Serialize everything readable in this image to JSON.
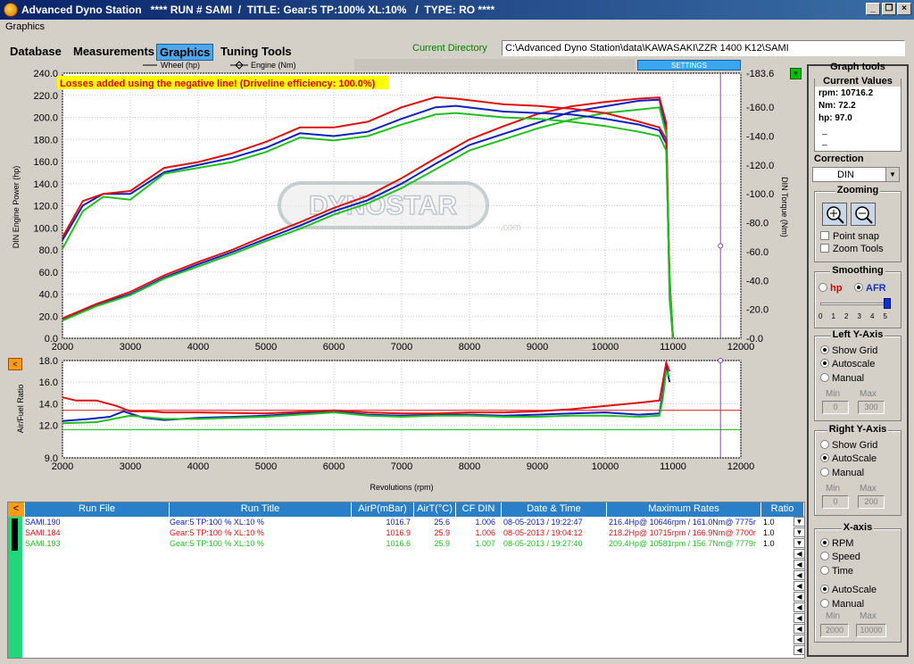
{
  "window": {
    "title": "Advanced Dyno Station   **** RUN # SAMI  /  TITLE: Gear:5 TP:100% XL:10%   /  TYPE: RO ****",
    "menu": "Graphics"
  },
  "tabs": [
    "Database",
    "Measurements",
    "Graphics",
    "Tuning Tools"
  ],
  "current_directory": {
    "label": "Current Directory",
    "value": "C:\\Advanced Dyno Station\\data\\KAWASAKI\\ZZR 1400 K12\\SAMI"
  },
  "settings_label": "SETTINGS",
  "loss_note": "Losses added using the negative line! (Driveline efficiency: 100.0%)",
  "watermark": "DYNOSTAR",
  "watermark_sub": ".com",
  "chart_data": [
    {
      "type": "line",
      "legend": [
        "Wheel (hp)",
        "Engine (Nm)"
      ],
      "xlabel": "",
      "ylabel": "DIN Engine Power (hp)",
      "y2label": "DIN Torque (Nm)",
      "xlim": [
        2000,
        12000
      ],
      "ylim": [
        0,
        240
      ],
      "y2lim": [
        0,
        183.6
      ],
      "x_ticks": [
        2000,
        3000,
        4000,
        5000,
        6000,
        7000,
        8000,
        9000,
        10000,
        11000,
        12000
      ],
      "y_ticks": [
        "0.0",
        "20.0",
        "40.0",
        "60.0",
        "80.0",
        "100.0",
        "120.0",
        "140.0",
        "160.0",
        "180.0",
        "200.0",
        "220.0",
        "240.0"
      ],
      "y2_ticks": [
        "-0.0",
        "-20.0",
        "-40.0",
        "-60.0",
        "-80.0",
        "-100.0",
        "-120.0",
        "-140.0",
        "-160.0",
        "-183.6"
      ],
      "cursor_rpm": 11700,
      "series": [
        {
          "name": "SAMI.190 hp",
          "color": "#1020c0",
          "x": [
            2000,
            2500,
            3000,
            3500,
            4000,
            4500,
            5000,
            5500,
            6000,
            6500,
            7000,
            7500,
            8000,
            8500,
            9000,
            9500,
            10000,
            10500,
            10800,
            10900,
            10950,
            11000
          ],
          "values": [
            17,
            30,
            40,
            55,
            67,
            78,
            90,
            102,
            115,
            125,
            140,
            158,
            175,
            185,
            195,
            205,
            210,
            215,
            216,
            190,
            40,
            0
          ]
        },
        {
          "name": "SAMI.184 hp",
          "color": "#e01010",
          "x": [
            2000,
            2500,
            3000,
            3500,
            4000,
            4500,
            5000,
            5500,
            6000,
            6500,
            7000,
            7500,
            8000,
            8500,
            9000,
            9500,
            10000,
            10500,
            10800,
            10900,
            10950,
            11000
          ],
          "values": [
            18,
            31,
            42,
            57,
            69,
            80,
            93,
            105,
            118,
            129,
            145,
            163,
            180,
            192,
            203,
            210,
            214,
            217,
            218,
            195,
            45,
            0
          ]
        },
        {
          "name": "SAMI.193 hp",
          "color": "#20c020",
          "x": [
            2000,
            2500,
            3000,
            3500,
            4000,
            4500,
            5000,
            5500,
            6000,
            6500,
            7000,
            7500,
            8000,
            8500,
            9000,
            9500,
            10000,
            10500,
            10800,
            10900,
            10950,
            11000
          ],
          "values": [
            16,
            29,
            39,
            54,
            65,
            76,
            88,
            99,
            112,
            122,
            136,
            153,
            170,
            180,
            190,
            198,
            204,
            207,
            209,
            185,
            35,
            0
          ]
        },
        {
          "name": "SAMI.190 Nm",
          "color": "#1020c0",
          "x": [
            2000,
            2300,
            2600,
            3000,
            3500,
            4000,
            4500,
            5000,
            5500,
            6000,
            6500,
            7000,
            7500,
            7800,
            8500,
            9000,
            9500,
            10000,
            10500,
            10800,
            10900,
            10950,
            11000
          ],
          "values": [
            68,
            92,
            100,
            100,
            115,
            120,
            125,
            132,
            142,
            140,
            143,
            152,
            160,
            161,
            157,
            156,
            155,
            152,
            148,
            144,
            135,
            40,
            0
          ]
        },
        {
          "name": "SAMI.184 Nm",
          "color": "#e01010",
          "x": [
            2000,
            2300,
            2600,
            3000,
            3500,
            4000,
            4500,
            5000,
            5500,
            6000,
            6500,
            7000,
            7500,
            7800,
            8500,
            9000,
            9500,
            10000,
            10500,
            10800,
            10900,
            10950,
            11000
          ],
          "values": [
            70,
            95,
            100,
            102,
            118,
            122,
            128,
            136,
            146,
            146,
            150,
            160,
            167,
            166,
            162,
            161,
            159,
            156,
            150,
            146,
            138,
            42,
            0
          ]
        },
        {
          "name": "SAMI.193 Nm",
          "color": "#20c020",
          "x": [
            2000,
            2300,
            2600,
            3000,
            3500,
            4000,
            4500,
            5000,
            5500,
            6000,
            6500,
            7000,
            7500,
            7800,
            8500,
            9000,
            9500,
            10000,
            10500,
            10800,
            10900,
            10950,
            11000
          ],
          "values": [
            62,
            88,
            98,
            96,
            114,
            118,
            122,
            129,
            139,
            137,
            140,
            148,
            155,
            156,
            153,
            152,
            150,
            147,
            143,
            140,
            130,
            38,
            0
          ]
        }
      ]
    },
    {
      "type": "line",
      "xlabel": "Revolutions (rpm)",
      "ylabel": "Air/Fuel Ratio",
      "xlim": [
        2000,
        12000
      ],
      "ylim": [
        9.0,
        18.0
      ],
      "x_ticks": [
        2000,
        3000,
        4000,
        5000,
        6000,
        7000,
        8000,
        9000,
        10000,
        11000,
        12000
      ],
      "y_ticks": [
        "9.0",
        "12.0",
        "14.0",
        "16.0",
        "18.0"
      ],
      "reference_lines": [
        {
          "value": 13.4,
          "color": "#e01010"
        },
        {
          "value": 11.6,
          "color": "#20c020"
        }
      ],
      "series": [
        {
          "name": "SAMI.190 AFR",
          "color": "#1020c0",
          "x": [
            2000,
            2400,
            2700,
            2900,
            3200,
            3500,
            4000,
            5000,
            6000,
            6500,
            7000,
            7500,
            8000,
            8500,
            9000,
            9500,
            10000,
            10500,
            10800,
            10850,
            10900,
            10950
          ],
          "values": [
            12.4,
            12.6,
            12.8,
            13.3,
            12.7,
            12.5,
            12.7,
            12.9,
            13.3,
            13.0,
            12.9,
            13.0,
            13.0,
            12.9,
            13.0,
            13.1,
            13.2,
            13.0,
            13.1,
            15.0,
            17.5,
            16.0
          ]
        },
        {
          "name": "SAMI.184 AFR",
          "color": "#e01010",
          "x": [
            2000,
            2200,
            2500,
            2800,
            3000,
            3300,
            3500,
            4000,
            5000,
            6000,
            6500,
            7000,
            7500,
            8000,
            8500,
            9000,
            9500,
            10000,
            10500,
            10800,
            10850,
            10900,
            10950
          ],
          "values": [
            14.6,
            14.3,
            14.3,
            13.8,
            13.3,
            13.3,
            13.2,
            13.2,
            13.1,
            13.4,
            13.2,
            13.1,
            13.1,
            13.2,
            13.2,
            13.3,
            13.5,
            13.8,
            14.1,
            14.3,
            16.0,
            17.8,
            17.0
          ]
        },
        {
          "name": "SAMI.193 AFR",
          "color": "#20c020",
          "x": [
            2000,
            2500,
            3000,
            3500,
            4000,
            5000,
            6000,
            6500,
            7000,
            7500,
            8000,
            8500,
            9000,
            9500,
            10000,
            10500,
            10800,
            10850,
            10900,
            10950
          ],
          "values": [
            12.2,
            12.3,
            12.9,
            12.6,
            12.6,
            12.8,
            13.2,
            12.9,
            12.8,
            12.9,
            12.9,
            12.8,
            12.8,
            12.9,
            12.9,
            12.8,
            12.9,
            14.5,
            17.0,
            16.5
          ]
        }
      ]
    }
  ],
  "panel": {
    "title": "Graph tools",
    "current_values": {
      "title": "Current Values",
      "rpm": "rpm: 10716.2",
      "nm": "Nm: 72.2",
      "hp": "hp: 97.0",
      "dash1": "_",
      "dash2": "_"
    },
    "correction": {
      "title": "Correction",
      "value": "DIN"
    },
    "zooming": {
      "title": "Zooming",
      "point_snap": "Point snap",
      "zoom_tools": "Zoom Tools"
    },
    "smoothing": {
      "title": "Smoothing",
      "hp": "hp",
      "afr": "AFR",
      "scale": [
        "0",
        "1",
        "2",
        "3",
        "4",
        "5"
      ],
      "level": 5
    },
    "left_y": {
      "title": "Left Y-Axis",
      "opts": [
        "Show Grid",
        "Autoscale",
        "Manual"
      ],
      "min_label": "Min",
      "max_label": "Max",
      "min": "0",
      "max": "300"
    },
    "right_y": {
      "title": "Right Y-Axis",
      "opts": [
        "Show Grid",
        "AutoScale",
        "Manual"
      ],
      "min_label": "Min",
      "max_label": "Max",
      "min": "0",
      "max": "200"
    },
    "x_axis": {
      "title": "X-axis",
      "opts": [
        "RPM",
        "Speed",
        "Time",
        "AutoScale",
        "Manual"
      ],
      "min_label": "Min",
      "max_label": "Max",
      "min": "2000",
      "max": "10000"
    }
  },
  "table": {
    "headers": [
      "Run File",
      "Run Title",
      "AirP(mBar)",
      "AirT(°C)",
      "CF DIN",
      "Date & Time",
      "Maximum Rates",
      "Ratio"
    ],
    "rows": [
      {
        "file": "SAMI.190",
        "title": "Gear:5 TP:100 % XL:10 %",
        "airp": "1016.7",
        "airt": "25.6",
        "cf": "1.006",
        "date": "08-05-2013 / 19:22:47",
        "max": "216.4Hp@ 10646rpm / 161.0Nm@ 7775r",
        "ratio": "1.0",
        "color": "#1020c0"
      },
      {
        "file": "SAMI.184",
        "title": "Gear:5 TP:100 % XL:10 %",
        "airp": "1016.9",
        "airt": "25.9",
        "cf": "1.006",
        "date": "08-05-2013 / 19:04:12",
        "max": "218.2Hp@ 10715rpm / 166.9Nm@ 7700r",
        "ratio": "1.0",
        "color": "#e01010"
      },
      {
        "file": "SAMI.193",
        "title": "Gear:5 TP:100 % XL:10 %",
        "airp": "1016.6",
        "airt": "25.9",
        "cf": "1.007",
        "date": "08-05-2013 / 19:27:40",
        "max": "209.4Hp@ 10581rpm / 156.7Nm@ 7779r",
        "ratio": "1.0",
        "color": "#20c020"
      }
    ]
  }
}
